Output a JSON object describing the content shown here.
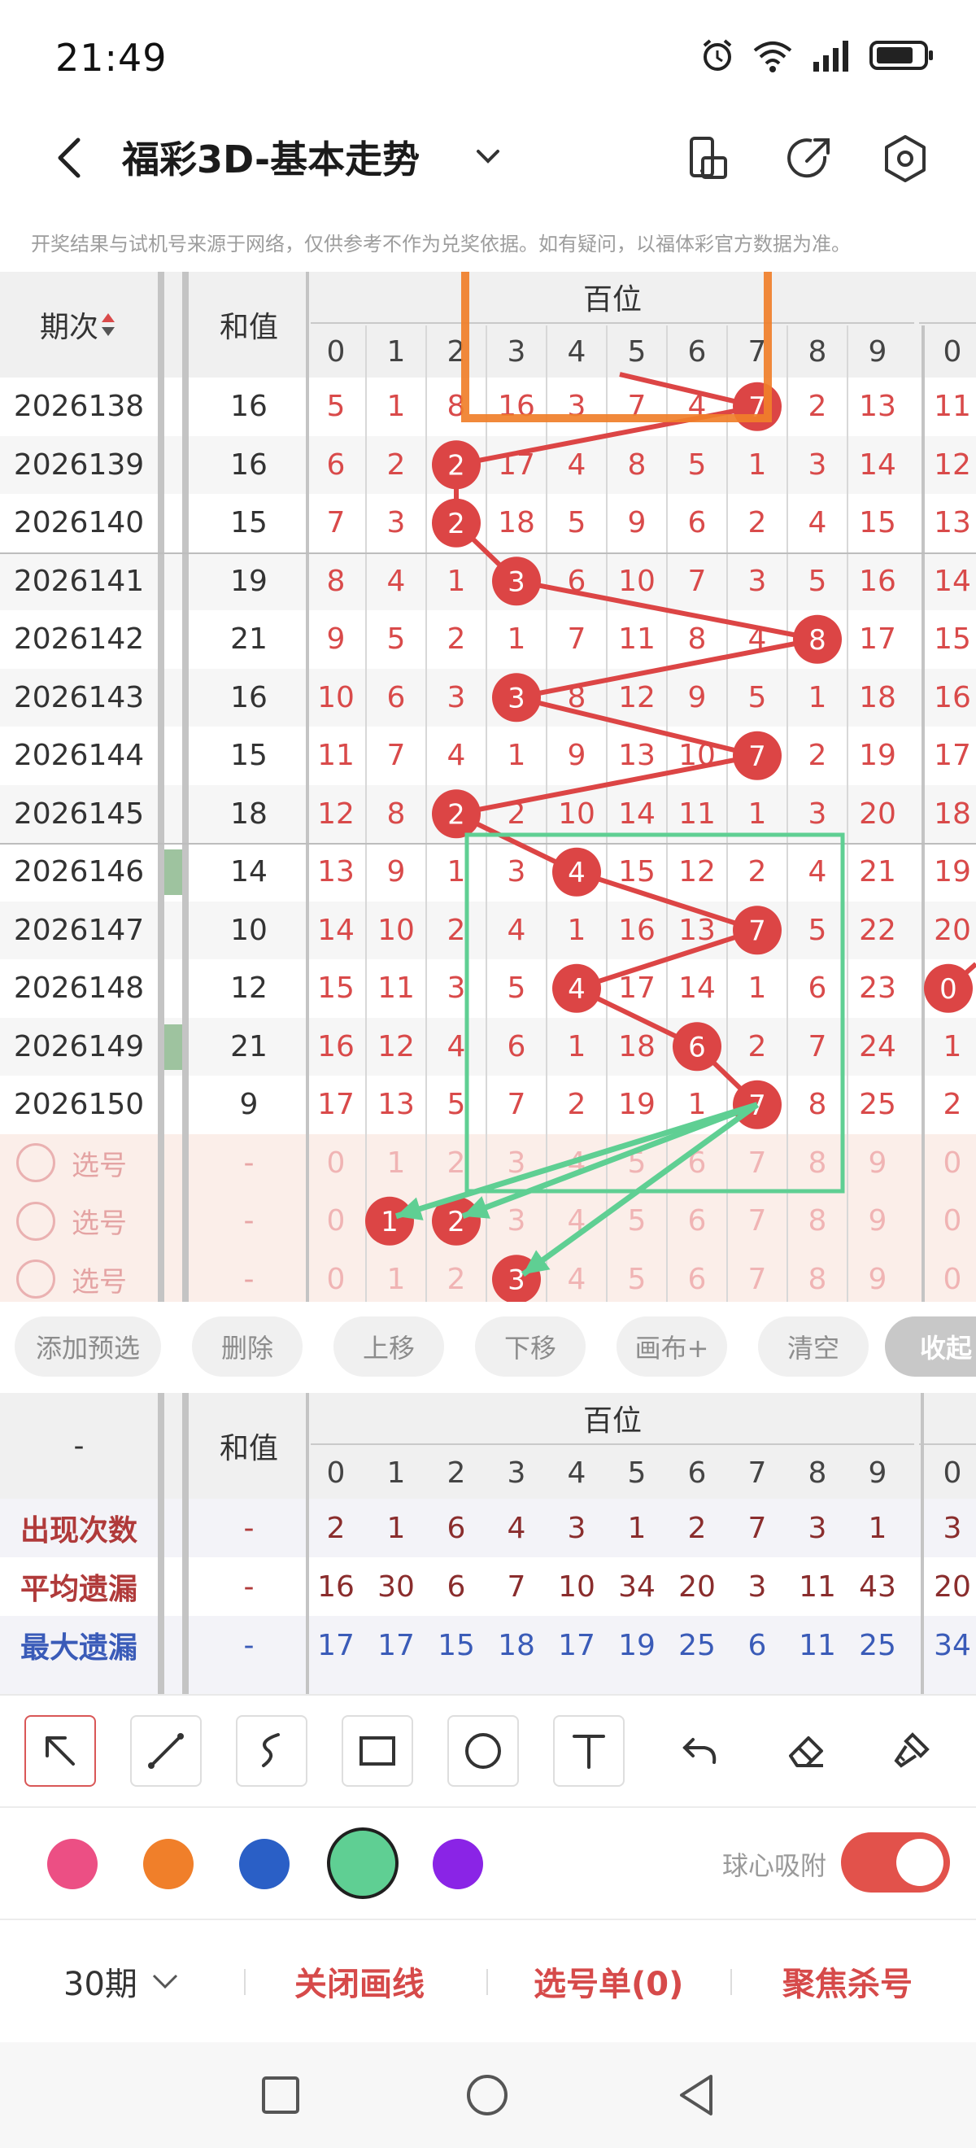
{
  "status": {
    "time": "21:49"
  },
  "header": {
    "title": "福彩3D-基本走势"
  },
  "notice": "开奖结果与试机号来源于网络，仅供参考不作为兑奖依据。如有疑问，以福体彩官方数据为准。",
  "table": {
    "col_period": "期次",
    "col_sum": "和值",
    "group": "百位",
    "digits": [
      "0",
      "1",
      "2",
      "3",
      "4",
      "5",
      "6",
      "7",
      "8",
      "9",
      "0"
    ],
    "rows": [
      {
        "period": "2026138",
        "sum": "16",
        "cells": [
          "5",
          "1",
          "8",
          "16",
          "3",
          "7",
          "4",
          "7",
          "2",
          "13",
          "11"
        ],
        "ball": 7,
        "marked": false
      },
      {
        "period": "2026139",
        "sum": "16",
        "cells": [
          "6",
          "2",
          "2",
          "17",
          "4",
          "8",
          "5",
          "1",
          "3",
          "14",
          "12"
        ],
        "ball": 2,
        "marked": false
      },
      {
        "period": "2026140",
        "sum": "15",
        "cells": [
          "7",
          "3",
          "2",
          "18",
          "5",
          "9",
          "6",
          "2",
          "4",
          "15",
          "13"
        ],
        "ball": 2,
        "marked": false
      },
      {
        "period": "2026141",
        "sum": "19",
        "cells": [
          "8",
          "4",
          "1",
          "3",
          "6",
          "10",
          "7",
          "3",
          "5",
          "16",
          "14"
        ],
        "ball": 3,
        "marked": false
      },
      {
        "period": "2026142",
        "sum": "21",
        "cells": [
          "9",
          "5",
          "2",
          "1",
          "7",
          "11",
          "8",
          "4",
          "8",
          "17",
          "15"
        ],
        "ball": 8,
        "marked": false
      },
      {
        "period": "2026143",
        "sum": "16",
        "cells": [
          "10",
          "6",
          "3",
          "3",
          "8",
          "12",
          "9",
          "5",
          "1",
          "18",
          "16"
        ],
        "ball": 3,
        "marked": false
      },
      {
        "period": "2026144",
        "sum": "15",
        "cells": [
          "11",
          "7",
          "4",
          "1",
          "9",
          "13",
          "10",
          "7",
          "2",
          "19",
          "17"
        ],
        "ball": 7,
        "marked": false
      },
      {
        "period": "2026145",
        "sum": "18",
        "cells": [
          "12",
          "8",
          "2",
          "2",
          "10",
          "14",
          "11",
          "1",
          "3",
          "20",
          "18"
        ],
        "ball": 2,
        "marked": false
      },
      {
        "period": "2026146",
        "sum": "14",
        "cells": [
          "13",
          "9",
          "1",
          "3",
          "4",
          "15",
          "12",
          "2",
          "4",
          "21",
          "19"
        ],
        "ball": 4,
        "marked": true
      },
      {
        "period": "2026147",
        "sum": "10",
        "cells": [
          "14",
          "10",
          "2",
          "4",
          "1",
          "16",
          "13",
          "7",
          "5",
          "22",
          "20"
        ],
        "ball": 7,
        "marked": false
      },
      {
        "period": "2026148",
        "sum": "12",
        "cells": [
          "15",
          "11",
          "3",
          "5",
          "4",
          "17",
          "14",
          "1",
          "6",
          "23",
          "0"
        ],
        "ball": 4,
        "marked": false
      },
      {
        "period": "2026149",
        "sum": "21",
        "cells": [
          "16",
          "12",
          "4",
          "6",
          "1",
          "18",
          "6",
          "2",
          "7",
          "24",
          "1"
        ],
        "ball": 6,
        "marked": true
      },
      {
        "period": "2026150",
        "sum": "9",
        "cells": [
          "17",
          "13",
          "5",
          "7",
          "2",
          "19",
          "1",
          "7",
          "8",
          "25",
          "2"
        ],
        "ball": 7,
        "marked": false
      }
    ],
    "select_rows": [
      {
        "label": "选号",
        "sum": "-",
        "cells": [
          "0",
          "1",
          "2",
          "3",
          "4",
          "5",
          "6",
          "7",
          "8",
          "9",
          "0"
        ],
        "ball": null
      },
      {
        "label": "选号",
        "sum": "-",
        "cells": [
          "0",
          "1",
          "2",
          "3",
          "4",
          "5",
          "6",
          "7",
          "8",
          "9",
          "0"
        ],
        "ball": [
          1,
          2
        ]
      },
      {
        "label": "选号",
        "sum": "-",
        "cells": [
          "0",
          "1",
          "2",
          "3",
          "4",
          "5",
          "6",
          "7",
          "8",
          "9",
          "0"
        ],
        "ball": [
          3
        ]
      }
    ]
  },
  "buttons": [
    "添加预选",
    "删除",
    "上移",
    "下移",
    "画布+",
    "清空",
    "收起"
  ],
  "stats": {
    "col_first": "-",
    "col_sum": "和值",
    "group": "百位",
    "digits": [
      "0",
      "1",
      "2",
      "3",
      "4",
      "5",
      "6",
      "7",
      "8",
      "9",
      "0"
    ],
    "rows": [
      {
        "label": "出现次数",
        "sum": "-",
        "color": "#b03a3a",
        "cells": [
          "2",
          "1",
          "6",
          "4",
          "3",
          "1",
          "2",
          "7",
          "3",
          "1",
          "3"
        ]
      },
      {
        "label": "平均遗漏",
        "sum": "-",
        "color": "#b03a3a",
        "cells": [
          "16",
          "30",
          "6",
          "7",
          "10",
          "34",
          "20",
          "3",
          "11",
          "43",
          "20"
        ]
      },
      {
        "label": "最大遗漏",
        "sum": "-",
        "color": "#3a5bb8",
        "cells": [
          "17",
          "17",
          "15",
          "18",
          "17",
          "19",
          "25",
          "6",
          "11",
          "25",
          "34"
        ]
      }
    ]
  },
  "colors": {
    "pink": "#ec4f84",
    "orange": "#f07f2a",
    "blue": "#2a5fc6",
    "green": "#5fcf93",
    "purple": "#8a24e6",
    "accent": "#dc4545"
  },
  "magnet_label": "球心吸附",
  "bottom": {
    "period": "30期",
    "close_draw": "关闭画线",
    "pick_list": "选号单(0)",
    "focus": "聚焦杀号"
  }
}
